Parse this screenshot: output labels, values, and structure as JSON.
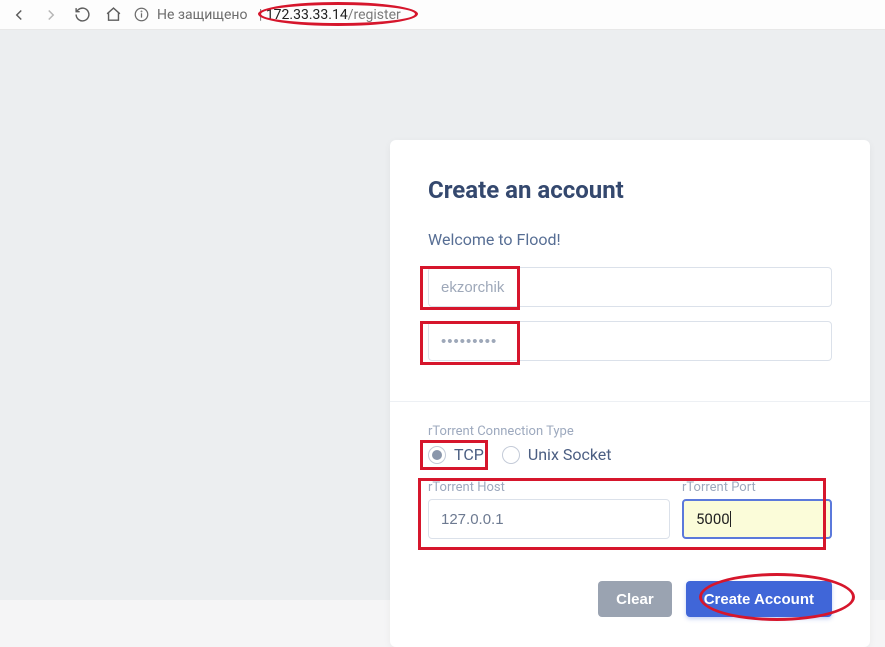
{
  "browser": {
    "secure_label": "Не защищено",
    "url_host": "172.33.33.14",
    "url_path": "/register"
  },
  "form": {
    "title": "Create an account",
    "welcome": "Welcome to Flood!",
    "username_value": "ekzorchik",
    "password_value": "•••••••••",
    "conn_type_label": "rTorrent Connection Type",
    "radio_tcp": "TCP",
    "radio_unix": "Unix Socket",
    "host_label": "rTorrent Host",
    "host_value": "127.0.0.1",
    "port_label": "rTorrent Port",
    "port_value": "5000",
    "clear_btn": "Clear",
    "create_btn": "Create Account"
  }
}
